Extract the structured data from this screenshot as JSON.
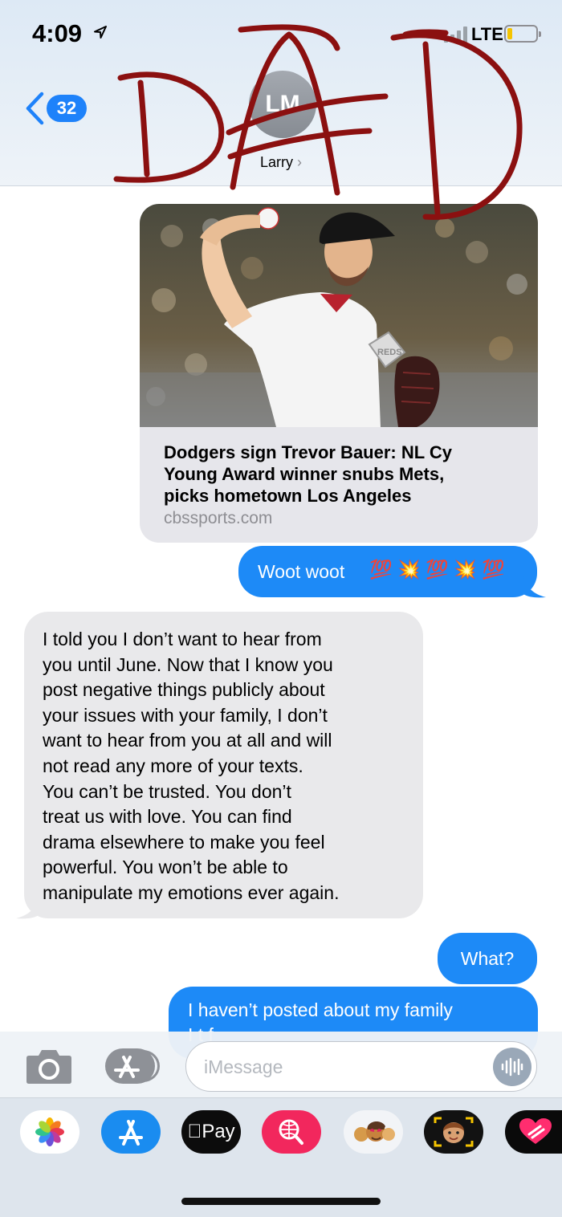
{
  "status_bar": {
    "time": "4:09",
    "network": "LTE",
    "location_icon": "location-arrow-icon",
    "battery_color": "#f5c400",
    "signal_bars_color": "#9aa1a8"
  },
  "nav": {
    "back_count": "32",
    "avatar_initials": "LM",
    "contact_name": "Larry",
    "accent": "#1e82fa"
  },
  "overlay": {
    "scribble_text": "DAD",
    "scribble_color": "#8b1010"
  },
  "messages": {
    "link_preview": {
      "title": "Dodgers sign Trevor Bauer: NL Cy Young Award winner snubs Mets, picks hometown Los Angeles",
      "title_lines": [
        "Dodgers sign Trevor Bauer: NL Cy",
        "Young Award winner snubs Mets,",
        "picks hometown Los Angeles"
      ],
      "domain": "cbssports.com",
      "photo_jersey_text": "REDS"
    },
    "woot": {
      "text": "Woot woot",
      "emoji": "💯 💥 💯 💥 💯"
    },
    "long_incoming": {
      "text": "I told you I don’t want to hear from you until June. Now that I know you post negative things publicly about your issues with your family, I don’t want to hear from you at all and will not read any more of your texts. You can’t be trusted. You don’t treat us with love. You can find drama elsewhere to make you feel powerful.  You won’t be able to manipulate my emotions ever again.",
      "lines": [
        "I told you I don’t want to hear from",
        "you until June. Now that I know you",
        "post negative things publicly about",
        "your issues with your family, I don’t",
        "want to hear from you at all and will",
        "not read any more of your texts.",
        "You can’t be trusted. You don’t",
        "treat us with love. You can find",
        "drama elsewhere to make you feel",
        "powerful.  You won’t be able to",
        "manipulate my emotions ever again."
      ]
    },
    "what": "What?",
    "partial": {
      "line1": "I haven’t posted about my family",
      "line2": "I      t     f"
    },
    "outgoing_color": "#1d8af7",
    "incoming_color": "#e9e9eb"
  },
  "compose": {
    "placeholder": "iMessage",
    "camera_icon": "camera-icon",
    "apps_icon": "app-store-icon",
    "audio_icon": "audio-waveform-icon"
  },
  "drawer": {
    "apple_pay_label": "Pay",
    "apps": [
      "photos-icon",
      "app-store-icon",
      "apple-pay-icon",
      "web-search-icon",
      "memoji-stickers-icon",
      "memoji-camera-icon",
      "heart-app-icon"
    ]
  }
}
